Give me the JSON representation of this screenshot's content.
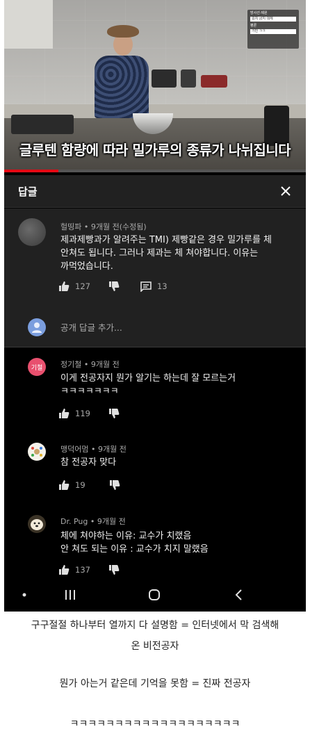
{
  "video": {
    "subtitle": "글루텐 함량에 따라 밀가루의 종류가 나뉘집니다",
    "overlay": {
      "label1": "방사선·제원",
      "field1": "김치 금지 대체",
      "label2": "평론",
      "field2": "가빈 ㅋㅋ"
    },
    "progress": 0.18,
    "accent_color": "#e50914"
  },
  "panel": {
    "title": "답글",
    "close_icon": "close-icon"
  },
  "parent_comment": {
    "author": "헐띵파",
    "time": "9개월 전(수정됨)",
    "text_lines": [
      "제과제빵과가 알려주는 TMI) 제빵같은 경우 밀가루를 체",
      "안쳐도 됩니다. 그러나 제과는 체 쳐야합니다. 이유는",
      "까먹었습니다."
    ],
    "likes": "127",
    "replies": "13"
  },
  "reply_input": {
    "placeholder": "공개 답글 추가..."
  },
  "replies": [
    {
      "author": "정기철",
      "time": "9개월 전",
      "avatar_text": "기철",
      "avatar_color": "#e8506e",
      "text_lines": [
        "이게 전공자지 뭔가 알기는 하는데 잘 모르는거",
        "ㅋㅋㅋㅋㅋㅋㅋ"
      ],
      "likes": "119"
    },
    {
      "author": "맹덕어멈",
      "time": "9개월 전",
      "text_lines": [
        "참 전공자 맞다"
      ],
      "likes": "19"
    },
    {
      "author": "Dr. Pug",
      "time": "9개월 전",
      "text_lines": [
        "체에 쳐야하는 이유: 교수가 치랬음",
        "안 쳐도 되는 이유 : 교수가 치지 말랬음"
      ],
      "likes": "137"
    }
  ],
  "caption": {
    "line1": "구구절절 하나부터 열까지 다 설명함 = 인터넷에서 막 검색해",
    "line2": "온 비전공자",
    "line3": "뭔가 아는거 같은데 기억을 못함 = 진짜 전공자",
    "line4": "ㅋㅋㅋㅋㅋㅋㅋㅋㅋㅋㅋㅋㅋㅋㅋㅋㅋㅋㅋ"
  }
}
